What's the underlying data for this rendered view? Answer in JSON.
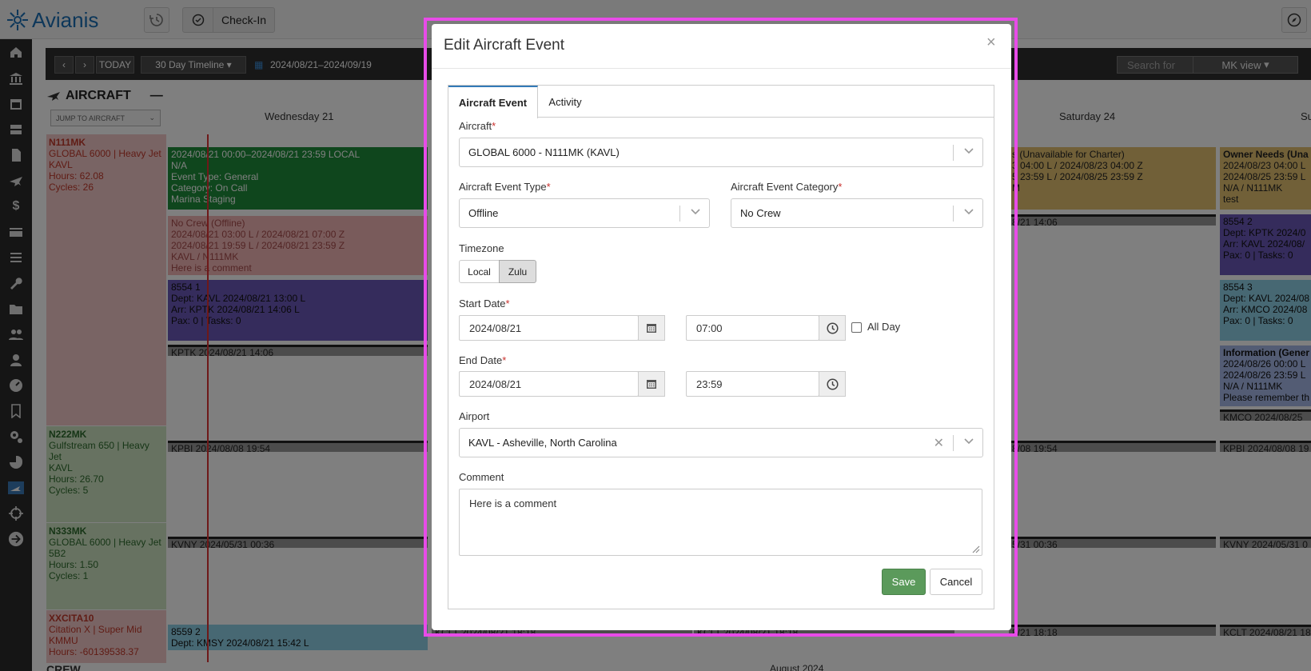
{
  "app": {
    "logo_text": "Avianis",
    "checkin_label": "Check-In"
  },
  "toolbar": {
    "today_label": "TODAY",
    "range_select": "30 Day Timeline",
    "date_range": "2024/08/21–2024/09/19",
    "search_placeholder": "Search for",
    "view_select": "MK view"
  },
  "aircraft_panel": {
    "title": "AIRCRAFT",
    "jump_placeholder": "JUMP TO AIRCRAFT"
  },
  "days": [
    "Wednesday 21",
    "Saturday 24",
    "Su"
  ],
  "month_label": "August 2024",
  "crew_label": "CREW",
  "aircraft_rows": [
    {
      "tail": "N111MK",
      "type": "GLOBAL 6000 | Heavy Jet",
      "base": "KAVL",
      "hours": "Hours: 62.08",
      "cycles": "Cycles: 26"
    },
    {
      "tail": "N222MK",
      "type": "Gulfstream 650 | Heavy Jet",
      "base": "KAVL",
      "hours": "Hours: 26.70",
      "cycles": "Cycles: 5"
    },
    {
      "tail": "N333MK",
      "type": "GLOBAL 6000 | Heavy Jet",
      "base": "5B2",
      "hours": "Hours: 1.50",
      "cycles": "Cycles: 1"
    },
    {
      "tail": "XXCITA10",
      "type": "Citation X | Super Mid",
      "base": "KMMU",
      "hours": "Hours: -60139538.37",
      "cycles": ""
    }
  ],
  "events": {
    "ev1": [
      "2024/08/21 00:00–2024/08/21 23:59 LOCAL",
      "N/A",
      "Event Type: General",
      "Category: On Call",
      "Marina Staging"
    ],
    "ev2": [
      "No Crew (Offline)",
      "2024/08/21 03:00 L / 2024/08/21 07:00 Z",
      "2024/08/21 19:59 L / 2024/08/21 23:59 Z",
      "KAVL / N111MK",
      "Here is a comment"
    ],
    "ev3": [
      "8554 1",
      "Dept: KAVL 2024/08/21 13:00 L",
      "Arr: KPTK 2024/08/21 14:06 L",
      "Pax: 0 | Tasks: 0"
    ],
    "bar_kptk": "KPTK 2024/08/21 14:06",
    "bar_kpbi": "KPBI 2024/08/08 19:54",
    "bar_kvny": "KVNY 2024/05/31 00:36",
    "ev4": [
      "8559 2",
      "Dept: KMSY 2024/08/21 15:42 L"
    ],
    "bar_kclt1": "KCLT 2024/08/21 18:18",
    "bar_kclt2": "KCLT 2024/08/21 18:18",
    "sat_ev": [
      "s (Unavailable for Charter)",
      "3 04:00 L / 2024/08/23 04:00 Z",
      "5 23:59 L / 2024/08/25 23:59 Z",
      "M"
    ],
    "sat_bar1": "8/21 14:06",
    "sat_bar2": "8/08 19:54",
    "sat_bar3": "5/31 00:36",
    "sat_bar4": "8/21 18:18",
    "sun_ev1": [
      "Owner Needs (Una",
      "2024/08/23 04:00 L",
      "2024/08/25 23:59 L",
      "N/A / N111MK",
      "test"
    ],
    "sun_ev2": [
      "8554 2",
      "Dept: KPTK 2024/0",
      "Arr: KAVL 2024/08/",
      "Pax: 0 | Tasks: 0"
    ],
    "sun_ev3": [
      "8554 3",
      "Dept: KAVL 2024/08",
      "Arr: KMCO 2024/08",
      "Pax: 0 | Tasks: 0"
    ],
    "sun_ev4": [
      "Information (Gener",
      "2024/08/26 00:00 L",
      "2024/08/26 23:59 L",
      "N/A / N111MK",
      "Please remember th"
    ],
    "sun_bar1": "KMCO 2024/08/25",
    "sun_bar2": "KPBI 2024/08/08 19",
    "sun_bar3": "KVNY 2024/05/31 0",
    "sun_bar4": "KCLT 2024/08/21 18"
  },
  "modal": {
    "title": "Edit Aircraft Event",
    "close": "×",
    "tabs": [
      "Aircraft Event",
      "Activity"
    ],
    "aircraft_label": "Aircraft",
    "aircraft_value": "GLOBAL 6000 - N111MK (KAVL)",
    "event_type_label": "Aircraft Event Type",
    "event_type_value": "Offline",
    "event_category_label": "Aircraft Event Category",
    "event_category_value": "No Crew",
    "timezone_label": "Timezone",
    "tz_local": "Local",
    "tz_zulu": "Zulu",
    "start_date_label": "Start Date",
    "start_date": "2024/08/21",
    "start_time": "07:00",
    "all_day_label": "All Day",
    "end_date_label": "End Date",
    "end_date": "2024/08/21",
    "end_time": "23:59",
    "airport_label": "Airport",
    "airport_value": "KAVL - Asheville, North Carolina",
    "comment_label": "Comment",
    "comment_value": "Here is a comment",
    "save": "Save",
    "cancel": "Cancel",
    "required_mark": "*"
  },
  "colors": {
    "accent": "#337ab7",
    "save": "#5b9a5b",
    "highlight": "#e84be8",
    "logo": "#1b6fb5"
  }
}
